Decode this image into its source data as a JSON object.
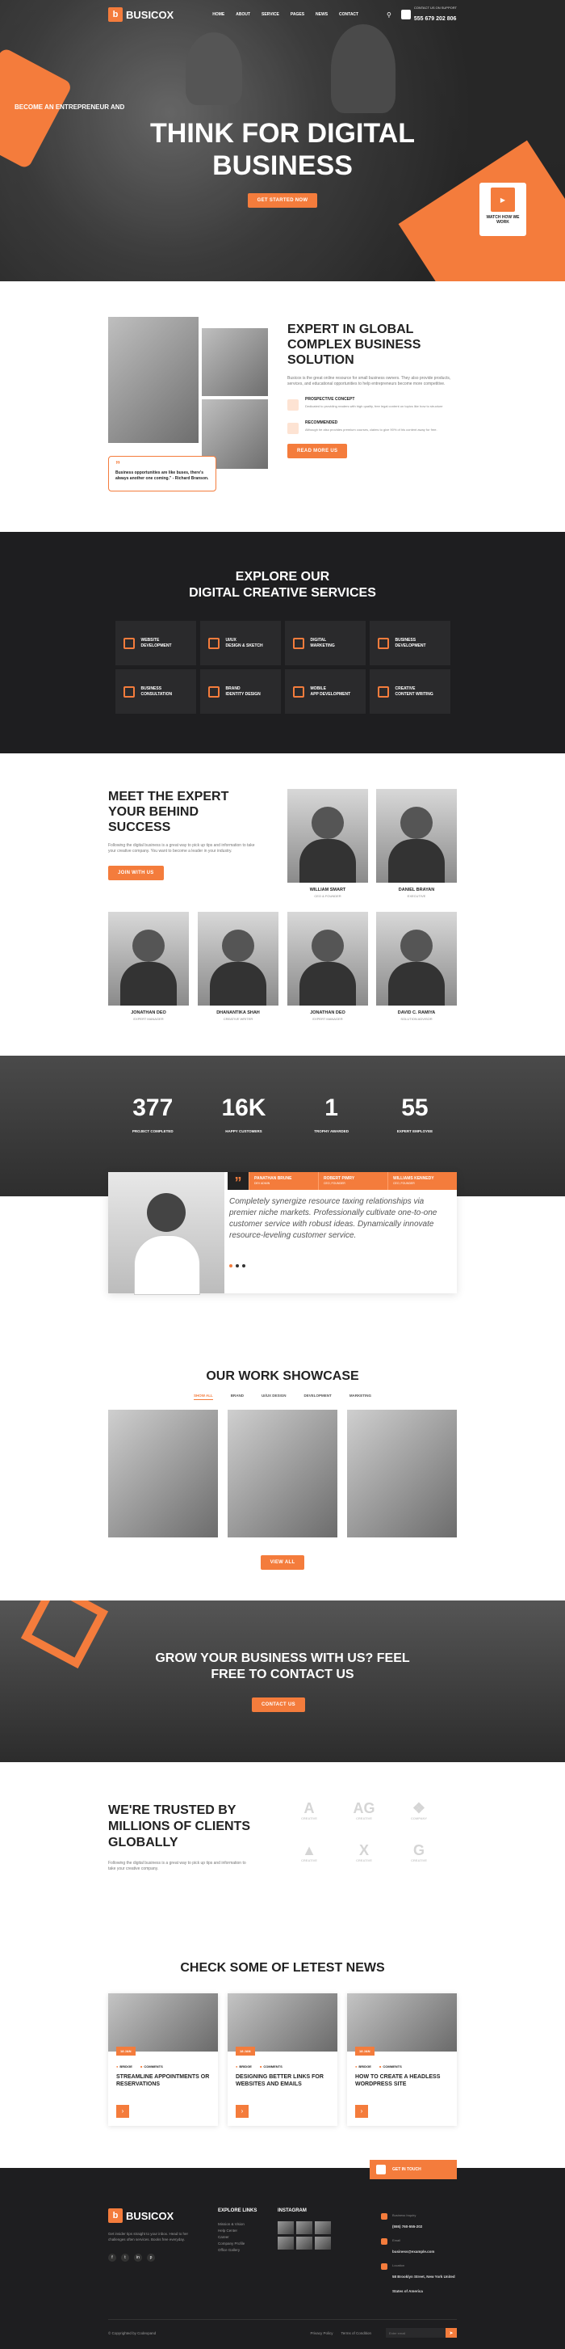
{
  "header": {
    "brand": "BUSICOX",
    "brand_mark": "b",
    "menu": [
      "HOME",
      "ABOUT",
      "SERVICE",
      "PAGES",
      "NEWS",
      "CONTACT"
    ],
    "call_label": "CONTACT US ON SUPPORT",
    "phone": "555 679 202 806"
  },
  "hero": {
    "subtitle": "BECOME AN ENTREPRENEUR AND",
    "title_line1": "THINK FOR DIGITAL",
    "title_line2": "BUSINESS",
    "button": "GET STARTED NOW",
    "video_label": "WATCH HOW WE WORK"
  },
  "about": {
    "title": "EXPERT IN GLOBAL COMPLEX BUSINESS SOLUTION",
    "text": "Busicox is the great online resource for small business owners. They also provide products, services, and educational opportunities to help entrepreneurs become more competitive.",
    "quote": "Business opportunities are like buses, there's always another one coming.\" - Richard Branson.",
    "features": [
      {
        "title": "PROSPECTIVE CONCEPT",
        "text": "Dedicated to providing readers with high quality, free legal content on topics like how to structure"
      },
      {
        "title": "RECOMMENDED",
        "text": "Although he also provides premium courses, claims to give 90% of his content away for free."
      }
    ],
    "button": "READ MORE US"
  },
  "services": {
    "title_line1": "EXPLORE OUR",
    "title_line2": "DIGITAL CREATIVE SERVICES",
    "items": [
      {
        "l1": "WEBSITE",
        "l2": "DEVELOPMENT"
      },
      {
        "l1": "UI/UX",
        "l2": "DESIGN & SKETCH"
      },
      {
        "l1": "DIGITAL",
        "l2": "MARKETING"
      },
      {
        "l1": "BUSINESS",
        "l2": "DEVELOPMENT"
      },
      {
        "l1": "BUSINESS",
        "l2": "CONSULTATION"
      },
      {
        "l1": "BRAND",
        "l2": "IDENTITY DESIGN"
      },
      {
        "l1": "MOBILE",
        "l2": "APP DEVELOPMENT"
      },
      {
        "l1": "CREATIVE",
        "l2": "CONTENT WRITING"
      }
    ]
  },
  "team": {
    "title": "MEET THE EXPERT YOUR BEHIND SUCCESS",
    "text": "Following the digital business is a great way to pick up tips and information to take your creative company. You want to become a leader in your industry.",
    "button": "JOIN WITH US",
    "members": [
      {
        "name": "WILLIAM SMART",
        "role": "CEO & FOUNDER"
      },
      {
        "name": "DANIEL BRAYAN",
        "role": "EXECUTIVE"
      },
      {
        "name": "JONATHAN DEO",
        "role": "EXPERT MANAGER"
      },
      {
        "name": "DHANANTIKA SHAH",
        "role": "CREATIVE WRITER"
      },
      {
        "name": "JONATHAN DEO",
        "role": "EXPERT MANAGER"
      },
      {
        "name": "DAVID C. RAMIYA",
        "role": "SOLUTION ADVISOR"
      }
    ]
  },
  "stats": [
    {
      "value": "377",
      "label": "PROJECT COMPLETED"
    },
    {
      "value": "16K",
      "label": "HAPPY CUSTOMERS"
    },
    {
      "value": "1",
      "label": "TROPHY AWARDED"
    },
    {
      "value": "55",
      "label": "EXPERT EMPLOYEE"
    }
  ],
  "testimonial": {
    "tabs": [
      {
        "name": "PANATHAN BRUNE",
        "role": "DEV ADMIN"
      },
      {
        "name": "ROBERT PIMRY",
        "role": "CEO, FOUNDER"
      },
      {
        "name": "WILLIAMS KENNEDY",
        "role": "CEO, FOUNDER"
      }
    ],
    "text": "Completely synergize resource taxing relationships via premier niche markets. Professionally cultivate one-to-one customer service with robust ideas. Dynamically innovate resource-leveling customer service."
  },
  "work": {
    "title": "OUR WORK SHOWCASE",
    "filters": [
      "SHOW ALL",
      "BRAND",
      "UI/UX DESIGN",
      "DEVELOPMENT",
      "MARKETING"
    ],
    "button": "VIEW ALL"
  },
  "cta": {
    "title_line1": "GROW YOUR BUSINESS WITH US? FEEL",
    "title_line2": "FREE TO CONTACT US",
    "button": "CONTACT US"
  },
  "trusted": {
    "title": "WE'RE TRUSTED BY MILLIONS OF CLIENTS GLOBALLY",
    "text": "Following the digital business is a great way to pick up tips and information to take your creative company.",
    "logos": [
      {
        "glyph": "A",
        "name": "CREATIVE"
      },
      {
        "glyph": "AG",
        "name": "CREATIVE"
      },
      {
        "glyph": "❖",
        "name": "COMPANY"
      },
      {
        "glyph": "▲",
        "name": "CREATIVE"
      },
      {
        "glyph": "X",
        "name": "CREATIVE"
      },
      {
        "glyph": "G",
        "name": "CREATIVE"
      }
    ]
  },
  "news": {
    "title": "CHECK SOME OF LETEST NEWS",
    "items": [
      {
        "date": "18 JAN",
        "author": "BRIDGE",
        "comments": "COMMENTS",
        "title": "STREAMLINE APPOINTMENTS OR RESERVATIONS"
      },
      {
        "date": "18 JAN",
        "author": "BRIDGE",
        "comments": "COMMENTS",
        "title": "DESIGNING BETTER LINKS FOR WEBSITES AND EMAILS"
      },
      {
        "date": "18 JAN",
        "author": "BRIDGE",
        "comments": "COMMENTS",
        "title": "HOW TO CREATE A HEADLESS WORDPRESS SITE"
      }
    ]
  },
  "footer": {
    "about": "Get insider tips straight to your inbox. Head to her challenges often services. Books free everyday.",
    "social": [
      "f",
      "t",
      "in",
      "p"
    ],
    "links_title": "EXPLORE LINKS",
    "links": [
      "Mission & Vision",
      "Help Center",
      "Career",
      "Company Profile",
      "Office Gallery"
    ],
    "insta_title": "INSTAGRAM",
    "touch": "GET IN TOUCH",
    "contacts": [
      {
        "label": "Business Inquiry",
        "value": "(555) 760-555-202"
      },
      {
        "label": "Email",
        "value": "business@example.com"
      },
      {
        "label": "Location",
        "value": "58 Brooklyn Street, New York United States of America"
      }
    ],
    "copyright": "© Copyrighted by Codexpand",
    "bottom_links": [
      "Privacy Policy",
      "Terms of Condition"
    ],
    "subscribe_placeholder": "Enter email"
  }
}
